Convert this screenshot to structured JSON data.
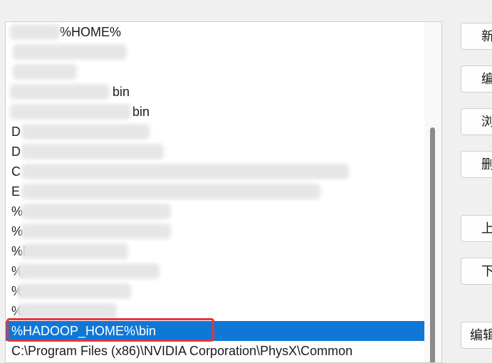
{
  "path_list": {
    "visible_rows": [
      "%HOME%",
      "",
      "",
      "bin",
      "bin",
      "D",
      "D",
      "C",
      "E",
      "%",
      "%",
      "%bin",
      "%",
      "%",
      "%",
      "%HADOOP_HOME%\\bin",
      "C:\\Program Files (x86)\\NVIDIA Corporation\\PhysX\\Common"
    ],
    "selected_index": 15,
    "selected_value": "%HADOOP_HOME%\\bin"
  },
  "buttons": {
    "new_label": "新",
    "edit_label": "编",
    "browse_label": "浏",
    "delete_label": "删",
    "move_up_label": "上",
    "move_down_label": "下",
    "edit_text_label": "编辑"
  },
  "colors": {
    "selection_bg": "#0f78d7",
    "highlight_border": "#e5363c"
  }
}
